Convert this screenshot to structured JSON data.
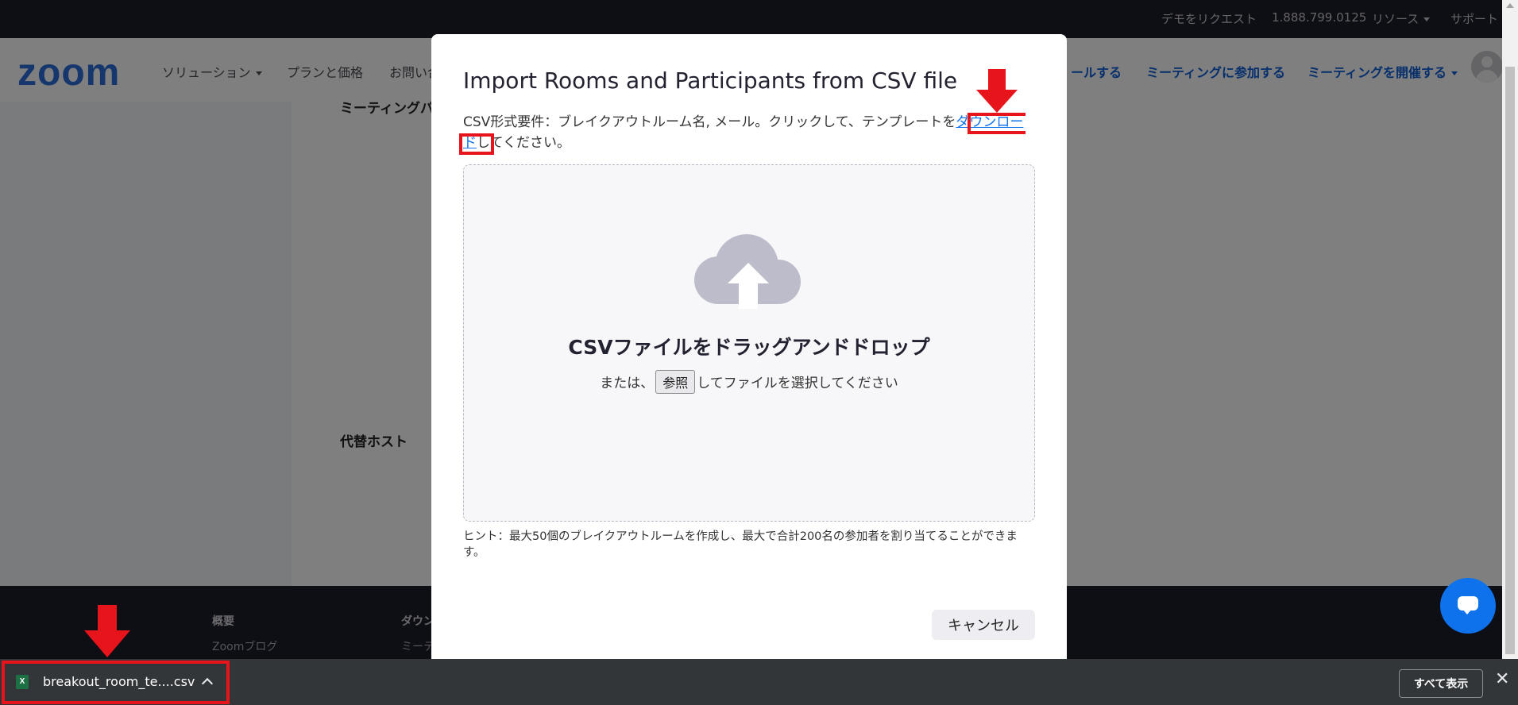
{
  "topbar": {
    "request_demo": "デモをリクエスト",
    "phone": "1.888.799.0125",
    "resources": "リソース",
    "support": "サポート"
  },
  "nav": {
    "logo": "zoom",
    "solutions": "ソリューション",
    "plans": "プランと価格",
    "contact": "お問い合",
    "schedule": "ールする",
    "join": "ミーティングに参加する",
    "host": "ミーティングを開催する"
  },
  "content": {
    "section_meeting": "ミーティングパ",
    "section_alt_host": "代替ホスト"
  },
  "modal": {
    "title": "Import Rooms and Participants from CSV file",
    "desc_prefix": "CSV形式要件：ブレイクアウトルーム名, メール。クリックして、テンプレートを",
    "desc_link": "ダウンロード",
    "desc_suffix": "してください。",
    "drop_title": "CSVファイルをドラッグアンドドロップ",
    "drop_or": "または、",
    "browse": "参照",
    "drop_after": "してファイルを選択してください",
    "hint": "ヒント：最大50個のブレイクアウトルームを作成し、最大で合計200名の参加者を割り当てることができます。",
    "cancel": "キャンセル"
  },
  "footer": {
    "col1_title": "概要",
    "col1_item": "Zoomブログ",
    "col2_title": "ダウン",
    "col2_item": "ミーテ"
  },
  "download_bar": {
    "file_name": "breakout_room_te....csv",
    "file_icon_letter": "X",
    "show_all": "すべて表示",
    "close": "✕"
  },
  "colors": {
    "zoom_blue": "#2d6fdb",
    "link_blue": "#0e72ed",
    "annotation_red": "#e8141c"
  }
}
